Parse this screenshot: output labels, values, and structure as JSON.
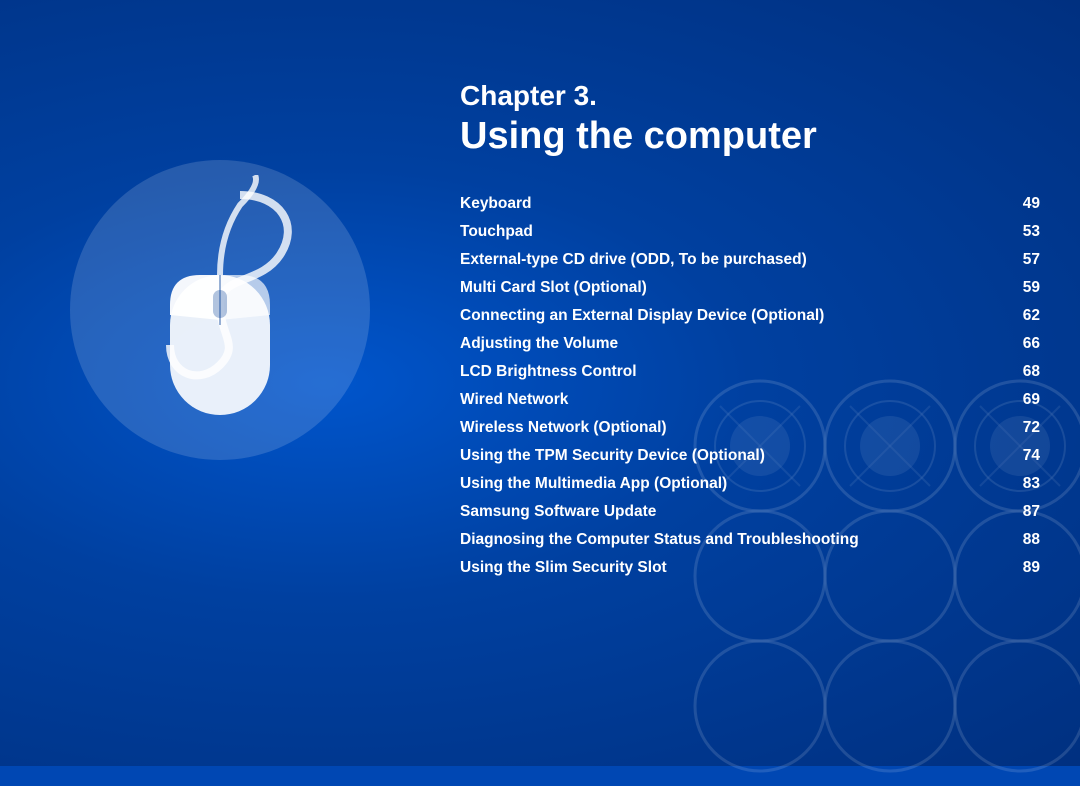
{
  "background": {
    "color": "#0047b3"
  },
  "chapter": {
    "label": "Chapter 3.",
    "title": "Using the computer"
  },
  "toc": {
    "items": [
      {
        "label": "Keyboard",
        "page": "49"
      },
      {
        "label": "Touchpad",
        "page": "53"
      },
      {
        "label": "External-type CD drive (ODD, To be purchased)",
        "page": "57"
      },
      {
        "label": "Multi Card Slot (Optional)",
        "page": "59"
      },
      {
        "label": "Connecting an External Display Device (Optional)",
        "page": "62"
      },
      {
        "label": "Adjusting the Volume",
        "page": "66"
      },
      {
        "label": "LCD Brightness Control",
        "page": "68"
      },
      {
        "label": "Wired Network",
        "page": "69"
      },
      {
        "label": "Wireless Network (Optional)",
        "page": "72"
      },
      {
        "label": "Using the TPM Security Device (Optional)",
        "page": "74"
      },
      {
        "label": "Using the Multimedia App (Optional)",
        "page": "83"
      },
      {
        "label": "Samsung Software Update",
        "page": "87"
      },
      {
        "label": "Diagnosing the Computer Status and Troubleshooting",
        "page": "88"
      },
      {
        "label": "Using the Slim Security Slot",
        "page": "89"
      }
    ]
  }
}
